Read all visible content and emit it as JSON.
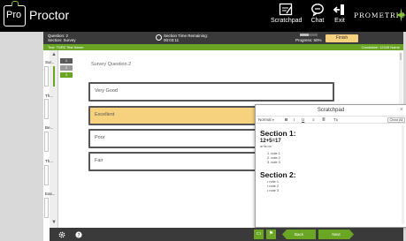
{
  "app": {
    "logo_mark": "Pro",
    "logo_text": "Proctor",
    "brand": "PROMETRIC"
  },
  "toolbar": {
    "scratchpad_label": "Scratchpad",
    "chat_label": "Chat",
    "exit_label": "Exit"
  },
  "header": {
    "question_number": "Question: 2",
    "section_name": "Section: Survey",
    "time_remaining_label": "Section Time Remaining:",
    "time_remaining_value": "00:03:11",
    "progress_label": "Progress: 50%",
    "progress_fraction": 0.5,
    "finish_label": "Finish"
  },
  "subheader": {
    "test_name": "Test: TNRZ Test Name",
    "candidate": "Candidate: 12345 Name"
  },
  "nav": {
    "sections": [
      {
        "label": "Sur..."
      },
      {
        "label": "Th..."
      },
      {
        "label": "Be..."
      },
      {
        "label": "Th..."
      },
      {
        "label": "Eas..."
      }
    ],
    "question_numbers": [
      "1",
      "2",
      "3"
    ],
    "up_icon": "chevron-up-icon",
    "down_icon": "chevron-down-icon"
  },
  "question": {
    "title": "Survey Question 2",
    "options": [
      {
        "label": "Very Good",
        "selected": false
      },
      {
        "label": "Excellent",
        "selected": true
      },
      {
        "label": "Poor",
        "selected": false
      },
      {
        "label": "Fair",
        "selected": false
      }
    ]
  },
  "scratchpad": {
    "title": "Scratchpad",
    "close_symbol": "×",
    "format_select": "Normal",
    "tools": [
      "B",
      "I",
      "U",
      "≡",
      "≣",
      "Tx"
    ],
    "clear_all": "Clear All",
    "section1_heading": "Section 1:",
    "equation": "12+5=17",
    "small_note": "a²+b²=c²",
    "ordered_notes": [
      "1. note 1",
      "2. note 2",
      "3. note 3"
    ],
    "section2_heading": "Section 2:",
    "bullet_notes": [
      "• note 1",
      "• note 2",
      "• note 3"
    ]
  },
  "footer": {
    "settings_icon": "gear-icon",
    "help_icon": "help-icon",
    "back_label": "Back",
    "next_label": "Next",
    "accent_color": "#6aa623",
    "highlight_color": "#f6d27e"
  }
}
